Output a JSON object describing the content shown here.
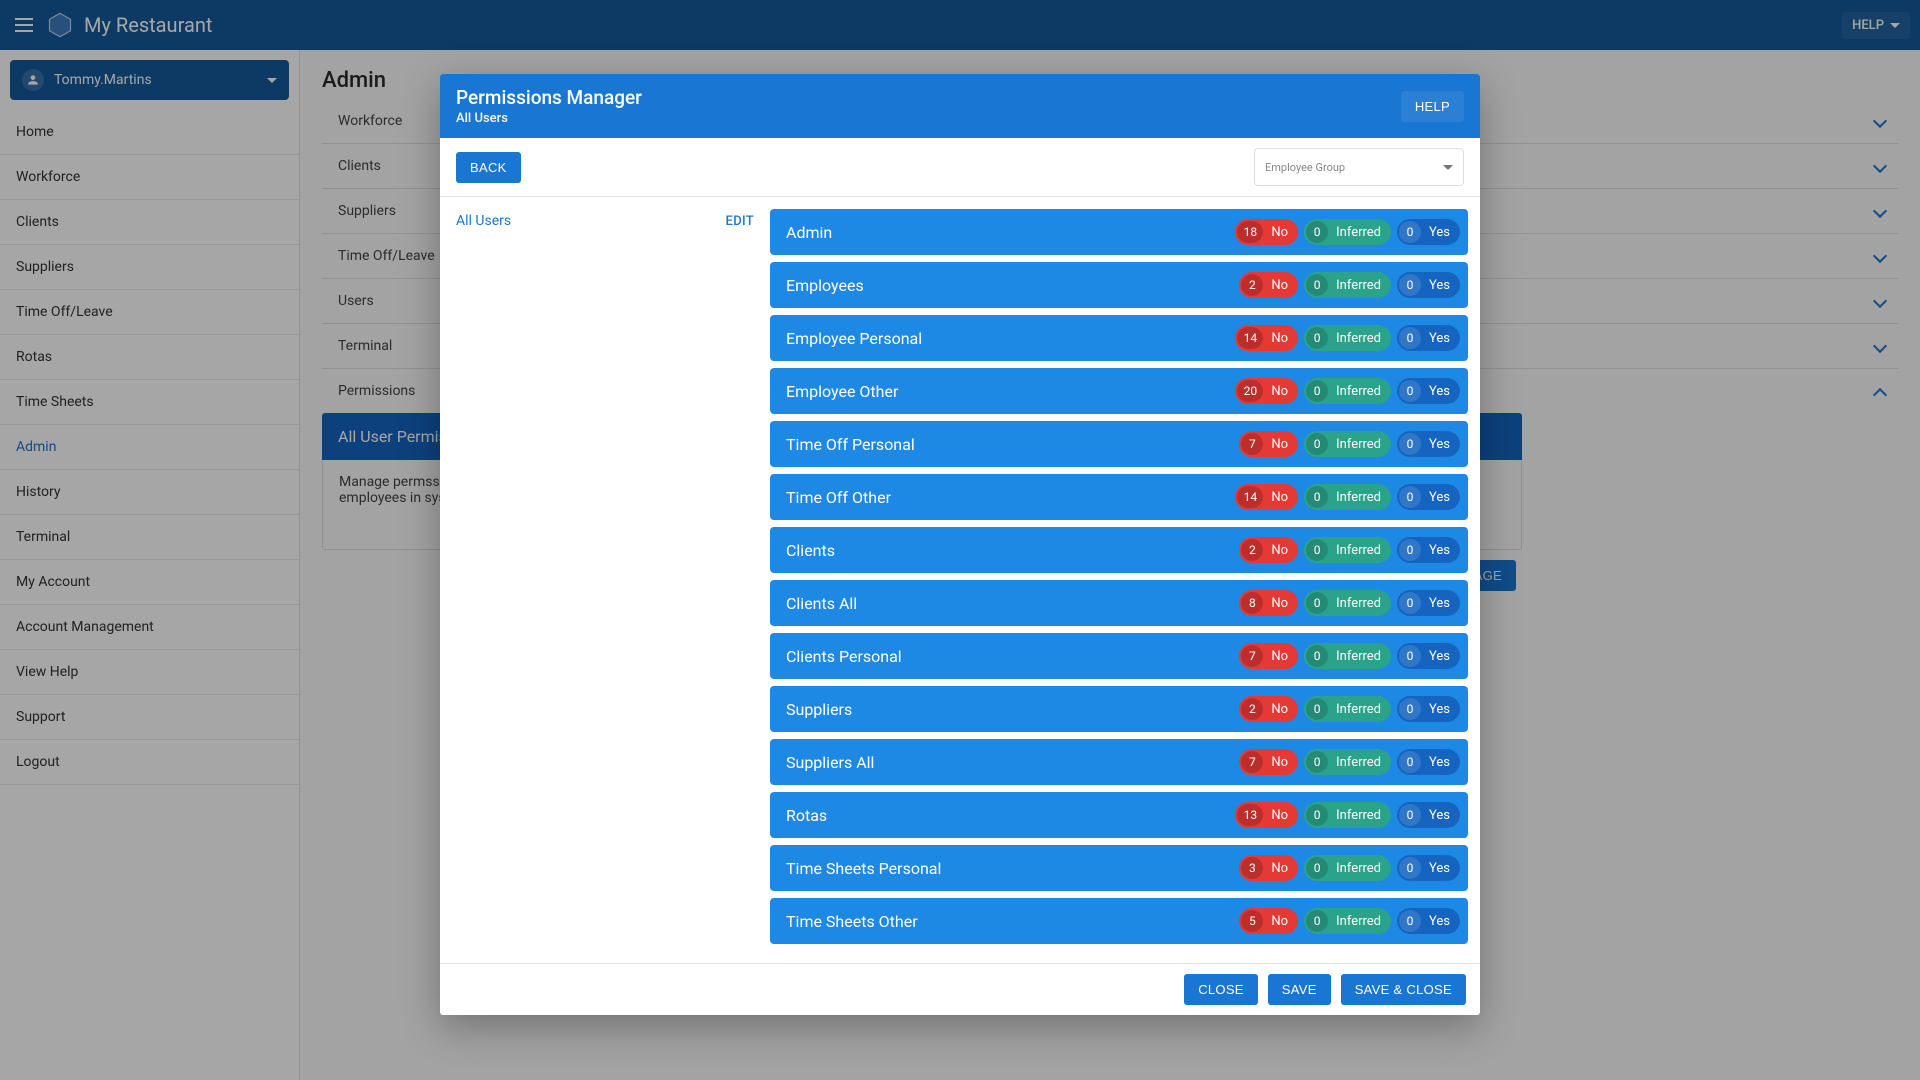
{
  "appbar": {
    "title": "My Restaurant",
    "help_label": "HELP"
  },
  "user": {
    "name": "Tommy.Martins"
  },
  "nav": [
    "Home",
    "Workforce",
    "Clients",
    "Suppliers",
    "Time Off/Leave",
    "Rotas",
    "Time Sheets",
    "Admin",
    "History",
    "Terminal",
    "My Account",
    "Account Management",
    "View Help",
    "Support",
    "Logout"
  ],
  "nav_active_index": 7,
  "page": {
    "title": "Admin",
    "sections": [
      "Workforce",
      "Clients",
      "Suppliers",
      "Time Off/Leave",
      "Users",
      "Terminal",
      "Permissions"
    ],
    "open_section_index": 6,
    "subpanel_title": "All User Permissions",
    "subpanel_body": "Manage permssions for all users and employees in system.",
    "manage_btn": "MANAGE"
  },
  "dialog": {
    "title": "Permissions Manager",
    "subtitle": "All Users",
    "help_label": "HELP",
    "back_label": "BACK",
    "emp_group_label": "Employee Group",
    "left": {
      "name": "All Users",
      "edit": "EDIT"
    },
    "badge_labels": {
      "no": "No",
      "inferred": "Inferred",
      "yes": "Yes"
    },
    "rows": [
      {
        "label": "Admin",
        "no": 18,
        "inf": 0,
        "yes": 0
      },
      {
        "label": "Employees",
        "no": 2,
        "inf": 0,
        "yes": 0
      },
      {
        "label": "Employee Personal",
        "no": 14,
        "inf": 0,
        "yes": 0
      },
      {
        "label": "Employee Other",
        "no": 20,
        "inf": 0,
        "yes": 0
      },
      {
        "label": "Time Off Personal",
        "no": 7,
        "inf": 0,
        "yes": 0
      },
      {
        "label": "Time Off Other",
        "no": 14,
        "inf": 0,
        "yes": 0
      },
      {
        "label": "Clients",
        "no": 2,
        "inf": 0,
        "yes": 0
      },
      {
        "label": "Clients All",
        "no": 8,
        "inf": 0,
        "yes": 0
      },
      {
        "label": "Clients Personal",
        "no": 7,
        "inf": 0,
        "yes": 0
      },
      {
        "label": "Suppliers",
        "no": 2,
        "inf": 0,
        "yes": 0
      },
      {
        "label": "Suppliers All",
        "no": 7,
        "inf": 0,
        "yes": 0
      },
      {
        "label": "Rotas",
        "no": 13,
        "inf": 0,
        "yes": 0
      },
      {
        "label": "Time Sheets Personal",
        "no": 3,
        "inf": 0,
        "yes": 0
      },
      {
        "label": "Time Sheets Other",
        "no": 5,
        "inf": 0,
        "yes": 0
      }
    ],
    "footer": {
      "close": "CLOSE",
      "save": "SAVE",
      "save_close": "SAVE & CLOSE"
    }
  }
}
